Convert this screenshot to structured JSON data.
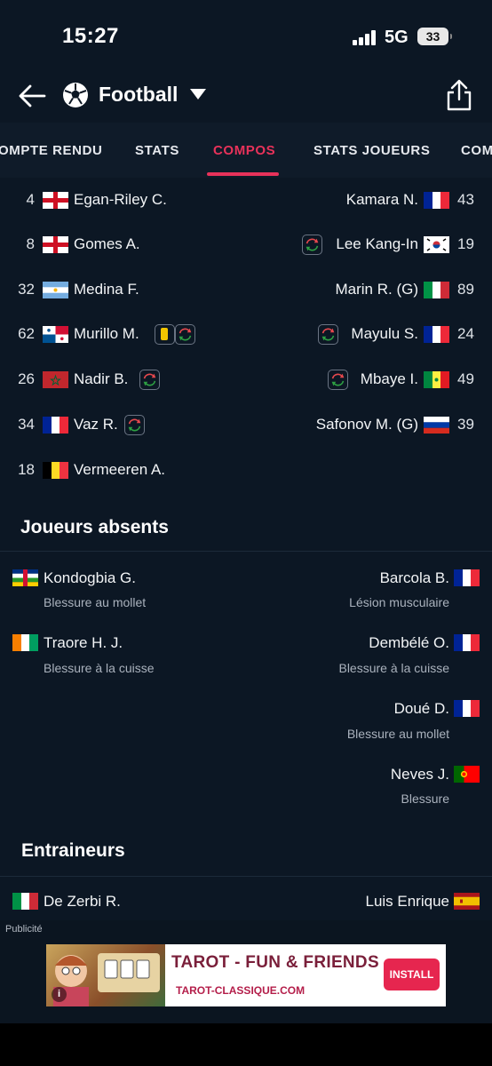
{
  "status_bar": {
    "time": "15:27",
    "network": "5G",
    "battery": "33"
  },
  "header": {
    "title": "Football"
  },
  "tabs": [
    {
      "label": "OMPTE RENDU"
    },
    {
      "label": "STATS"
    },
    {
      "label": "COMPOS"
    },
    {
      "label": "STATS JOUEURS"
    },
    {
      "label": "COM"
    }
  ],
  "active_tab": "COMPOS",
  "colors": {
    "accent": "#e8325a",
    "background": "#0c1724",
    "card_yellow": "#f2c500",
    "sub_green": "#2ea043",
    "sub_red": "#e5484d"
  },
  "lineup": {
    "home": [
      {
        "number": "4",
        "name": "Egan-Riley C.",
        "flag": "england",
        "icons": []
      },
      {
        "number": "8",
        "name": "Gomes A.",
        "flag": "england",
        "icons": []
      },
      {
        "number": "32",
        "name": "Medina F.",
        "flag": "argentina",
        "icons": []
      },
      {
        "number": "62",
        "name": "Murillo M.",
        "flag": "panama",
        "icons": [
          "yellow-card-icon",
          "substitution-icon"
        ]
      },
      {
        "number": "26",
        "name": "Nadir B.",
        "flag": "morocco",
        "icons": [
          "substitution-icon"
        ]
      },
      {
        "number": "34",
        "name": "Vaz R.",
        "flag": "france",
        "icons": [
          "substitution-icon"
        ]
      },
      {
        "number": "18",
        "name": "Vermeeren A.",
        "flag": "belgium",
        "icons": []
      }
    ],
    "away": [
      {
        "number": "43",
        "name": "Kamara N.",
        "flag": "france",
        "icons": []
      },
      {
        "number": "19",
        "name": "Lee Kang-In",
        "flag": "south-korea",
        "icons": [
          "substitution-icon"
        ]
      },
      {
        "number": "89",
        "name": "Marin R. (G)",
        "flag": "italy",
        "icons": []
      },
      {
        "number": "24",
        "name": "Mayulu S.",
        "flag": "france",
        "icons": [
          "substitution-icon"
        ]
      },
      {
        "number": "49",
        "name": "Mbaye I.",
        "flag": "senegal",
        "icons": [
          "substitution-icon"
        ]
      },
      {
        "number": "39",
        "name": "Safonov M. (G)",
        "flag": "russia",
        "icons": []
      }
    ]
  },
  "absent_section": {
    "title": "Joueurs absents",
    "home": [
      {
        "name": "Kondogbia G.",
        "reason": "Blessure au mollet",
        "flag": "central-african-republic"
      },
      {
        "name": "Traore H. J.",
        "reason": "Blessure à la cuisse",
        "flag": "ivory-coast"
      }
    ],
    "away": [
      {
        "name": "Barcola B.",
        "reason": "Lésion musculaire",
        "flag": "france"
      },
      {
        "name": "Dembélé O.",
        "reason": "Blessure à la cuisse",
        "flag": "france"
      },
      {
        "name": "Doué D.",
        "reason": "Blessure au mollet",
        "flag": "france"
      },
      {
        "name": "Neves J.",
        "reason": "Blessure",
        "flag": "portugal"
      }
    ]
  },
  "coaches_section": {
    "title": "Entraineurs",
    "home": {
      "name": "De Zerbi R.",
      "flag": "italy"
    },
    "away": {
      "name": "Luis Enrique",
      "flag": "spain"
    }
  },
  "ad": {
    "label": "Publicité",
    "title": "TAROT - FUN & FRIENDS",
    "url": "TAROT-CLASSIQUE.COM",
    "cta": "INSTALL",
    "info": "i"
  }
}
